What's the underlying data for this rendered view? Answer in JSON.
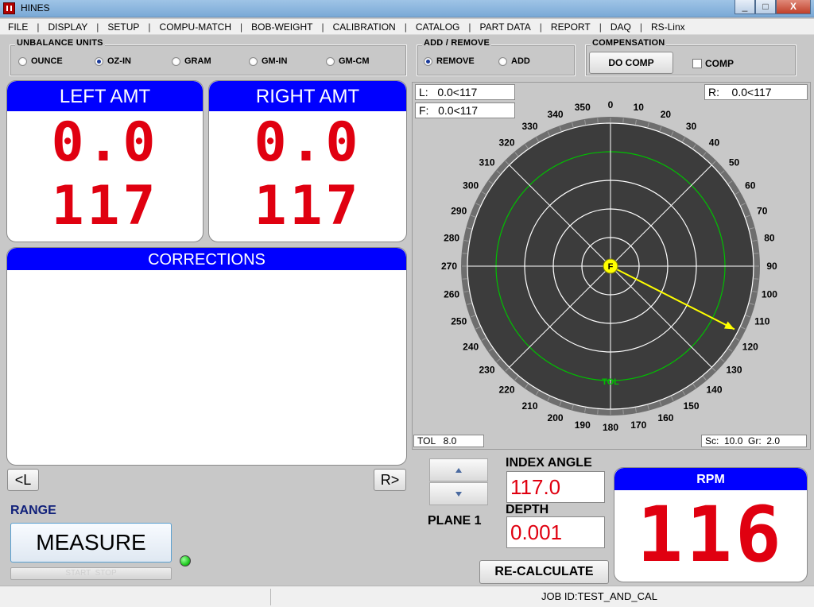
{
  "window": {
    "title": "HINES",
    "min_label": "_",
    "max_label": "□",
    "close_label": "X"
  },
  "menu": [
    "FILE",
    "DISPLAY",
    "SETUP",
    "COMPU-MATCH",
    "BOB-WEIGHT",
    "CALIBRATION",
    "CATALOG",
    "PART DATA",
    "REPORT",
    "DAQ",
    "RS-Linx"
  ],
  "menu_separator": "|",
  "unbalance_units": {
    "title": "UNBALANCE UNITS",
    "options": [
      "OUNCE",
      "OZ-IN",
      "GRAM",
      "GM-IN",
      "GM-CM"
    ],
    "selected": "OZ-IN"
  },
  "add_remove": {
    "title": "ADD / REMOVE",
    "options": [
      "REMOVE",
      "ADD"
    ],
    "selected": "REMOVE"
  },
  "compensation": {
    "title": "COMPENSATION",
    "do_comp_label": "DO COMP",
    "comp_label": "COMP",
    "comp_checked": false
  },
  "left_amt": {
    "title": "LEFT AMT",
    "amount": "0.0",
    "angle": "117"
  },
  "right_amt": {
    "title": "RIGHT AMT",
    "amount": "0.0",
    "angle": "117"
  },
  "corrections": {
    "title": "CORRECTIONS",
    "rows": []
  },
  "nav": {
    "prev_label": "<L",
    "next_label": "R>"
  },
  "range_label": "RANGE",
  "measure_label": "MEASURE",
  "measure_sub_label": "START  STOP",
  "polar": {
    "L_readout": "L:   0.0<117",
    "F_readout": "F:   0.0<117",
    "R_readout": "R:    0.0<117",
    "tol_readout": "TOL   8.0",
    "scale_readout": "Sc:  10.0  Gr:  2.0",
    "tol_ring_label": "TOL",
    "marker_label": "F",
    "angle_labels": [
      "0",
      "10",
      "20",
      "30",
      "40",
      "50",
      "60",
      "70",
      "80",
      "90",
      "100",
      "110",
      "120",
      "130",
      "140",
      "150",
      "160",
      "170",
      "180",
      "190",
      "200",
      "210",
      "220",
      "230",
      "240",
      "250",
      "260",
      "270",
      "280",
      "290",
      "300",
      "310",
      "320",
      "330",
      "340",
      "350"
    ],
    "vector_angle_deg": 117,
    "colors": {
      "face": "#3c3c3c",
      "bezel": "#6e6e6e",
      "grid": "#ffffff",
      "tol_ring": "#00c000",
      "vector": "#ffff00"
    }
  },
  "plane": {
    "up_icon": "up-arrow-icon",
    "down_icon": "down-arrow-icon",
    "label": "PLANE 1"
  },
  "index_angle": {
    "label": "INDEX ANGLE",
    "value": "117.0"
  },
  "depth": {
    "label": "DEPTH",
    "value": "0.001"
  },
  "recalculate_label": "RE-CALCULATE",
  "rpm": {
    "title": "RPM",
    "value": "116"
  },
  "status": {
    "job_id": "JOB ID:TEST_AND_CAL"
  },
  "theme": {
    "panel_header": "#0000ff",
    "digit_red": "#e00010",
    "status_led": "#22cc22"
  }
}
